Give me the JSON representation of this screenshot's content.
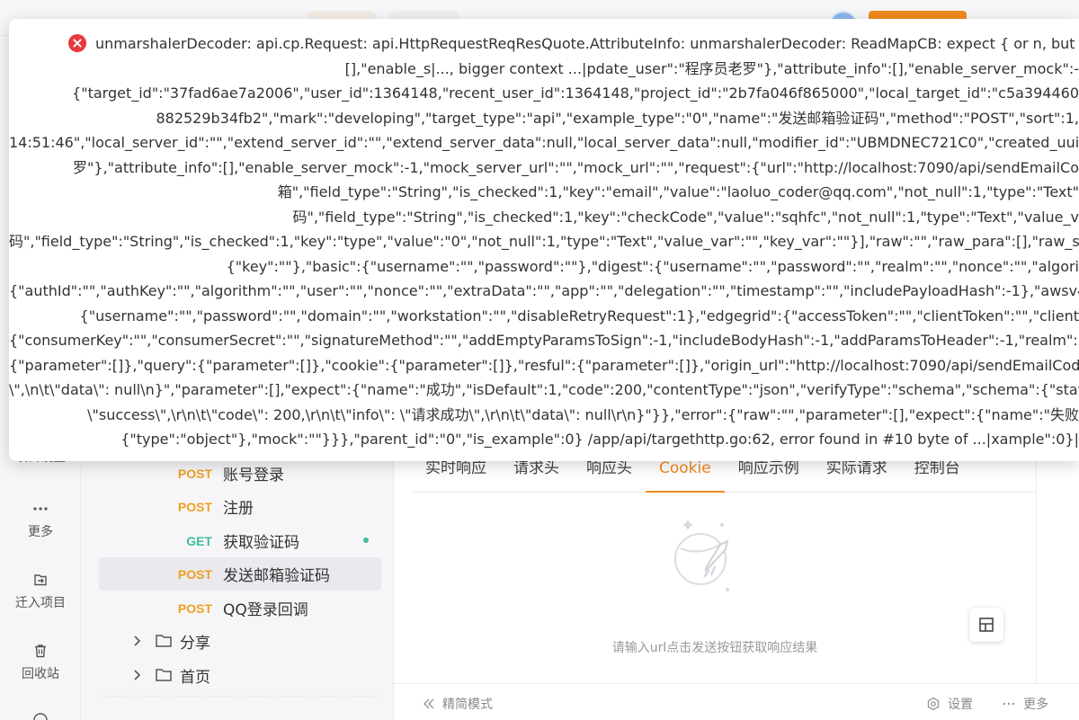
{
  "rail": {
    "items": [
      {
        "label": "项目设置",
        "icon": "settings-icon"
      },
      {
        "label": "更多",
        "icon": "more-dots-icon"
      },
      {
        "label": "迁入项目",
        "icon": "import-icon"
      },
      {
        "label": "回收站",
        "icon": "trash-icon"
      }
    ]
  },
  "tree": {
    "endpoints": [
      {
        "method": "POST",
        "name": "账号登录"
      },
      {
        "method": "POST",
        "name": "注册"
      },
      {
        "method": "GET",
        "name": "获取验证码"
      },
      {
        "method": "POST",
        "name": "发送邮箱验证码"
      },
      {
        "method": "POST",
        "name": "QQ登录回调"
      }
    ],
    "folders": [
      {
        "name": "分享"
      },
      {
        "name": "首页"
      }
    ]
  },
  "response": {
    "tabs": [
      "实时响应",
      "请求头",
      "响应头",
      "Cookie",
      "响应示例",
      "实际请求",
      "控制台"
    ],
    "active_tab": "Cookie",
    "empty_text": "请输入url点击发送按钮获取响应结果"
  },
  "statusbar": {
    "simple_mode": "精简模式",
    "settings": "设置",
    "more": "更多"
  },
  "error": {
    "lines": [
      "unmarshalerDecoder: api.cp.Request: api.HttpRequestReqResQuote.AttributeInfo: unmarshalerDecoder: ReadMapCB: expect { or n, but found [,",
      "[],\"enable_s|..., bigger context ...|pdate_user\":\"程序员老罗\"},\"attribute_info\":[],\"enable_server_mock\":-",
      "{\"target_id\":\"37fad6ae7a2006\",\"user_id\":1364148,\"recent_user_id\":1364148,\"project_id\":\"2b7fa046f865000\",\"local_target_id\":\"c5a394460",
      "882529b34fb2\",\"mark\":\"developing\",\"target_type\":\"api\",\"example_type\":\"0\",\"name\":\"发送邮箱验证码\",\"method\":\"POST\",\"sort\":1,",
      "14:51:46\",\"local_server_id\":\"\",\"extend_server_id\":\"\",\"extend_server_data\":null,\"local_server_data\":null,\"modifier_id\":\"UBMDNEC721C0\",\"created_uuid",
      "罗\"},\"attribute_info\":[],\"enable_server_mock\":-1,\"mock_server_url\":\"\",\"mock_url\":\"\",\"request\":{\"url\":\"http://localhost:7090/api/sendEmailCo",
      "箱\",\"field_type\":\"String\",\"is_checked\":1,\"key\":\"email\",\"value\":\"laoluo_coder@qq.com\",\"not_null\":1,\"type\":\"Text\"",
      "码\",\"field_type\":\"String\",\"is_checked\":1,\"key\":\"checkCode\",\"value\":\"sqhfc\",\"not_null\":1,\"type\":\"Text\",\"value_v",
      "码\",\"field_type\":\"String\",\"is_checked\":1,\"key\":\"type\",\"value\":\"0\",\"not_null\":1,\"type\":\"Text\",\"value_var\":\"\",\"key_var\":\"\"}],\"raw\":\"\",\"raw_para\":[],\"raw_schema",
      "{\"key\":\"\"},\"basic\":{\"username\":\"\",\"password\":\"\"},\"digest\":{\"username\":\"\",\"password\":\"\",\"realm\":\"\",\"nonce\":\"\",\"algori",
      "{\"authId\":\"\",\"authKey\":\"\",\"algorithm\":\"\",\"user\":\"\",\"nonce\":\"\",\"extraData\":\"\",\"app\":\"\",\"delegation\":\"\",\"timestamp\":\"\",\"includePayloadHash\":-1},\"awsv4\":{\"access",
      "{\"username\":\"\",\"password\":\"\",\"domain\":\"\",\"workstation\":\"\",\"disableRetryRequest\":1},\"edgegrid\":{\"accessToken\":\"\",\"clientToken\":\"\",\"client",
      "{\"consumerKey\":\"\",\"consumerSecret\":\"\",\"signatureMethod\":\"\",\"addEmptyParamsToSign\":-1,\"includeBodyHash\":-1,\"addParamsToHeader\":-1,\"realm\":\"\",\"versi",
      "{\"parameter\":[]},\"query\":{\"parameter\":[]},\"cookie\":{\"parameter\":[]},\"resful\":{\"parameter\":[]},\"origin_url\":\"http://localhost:7090/api/sendEmailCode\"},\"resp",
      "\\\",\\n\\t\\\"data\\\": null\\n}\",\"parameter\":[],\"expect\":{\"name\":\"成功\",\"isDefault\":1,\"code\":200,\"contentType\":\"json\",\"verifyType\":\"schema\",\"schema\":{\"status",
      "\\\"success\\\",\\r\\n\\t\\\"code\\\": 200,\\r\\n\\t\\\"info\\\": \\\"请求成功\\\",\\r\\n\\t\\\"data\\\": null\\r\\n}\"}},\"error\":{\"raw\":\"\",\"parameter\":[],\"expect\":{\"name\":\"失败",
      "{\"type\":\"object\"},\"mock\":\"\"}}},\"parent_id\":\"0\",\"is_example\":0} /app/api/targethttp.go:62, error found in #10 byte of ...|xample\":0}|"
    ]
  }
}
